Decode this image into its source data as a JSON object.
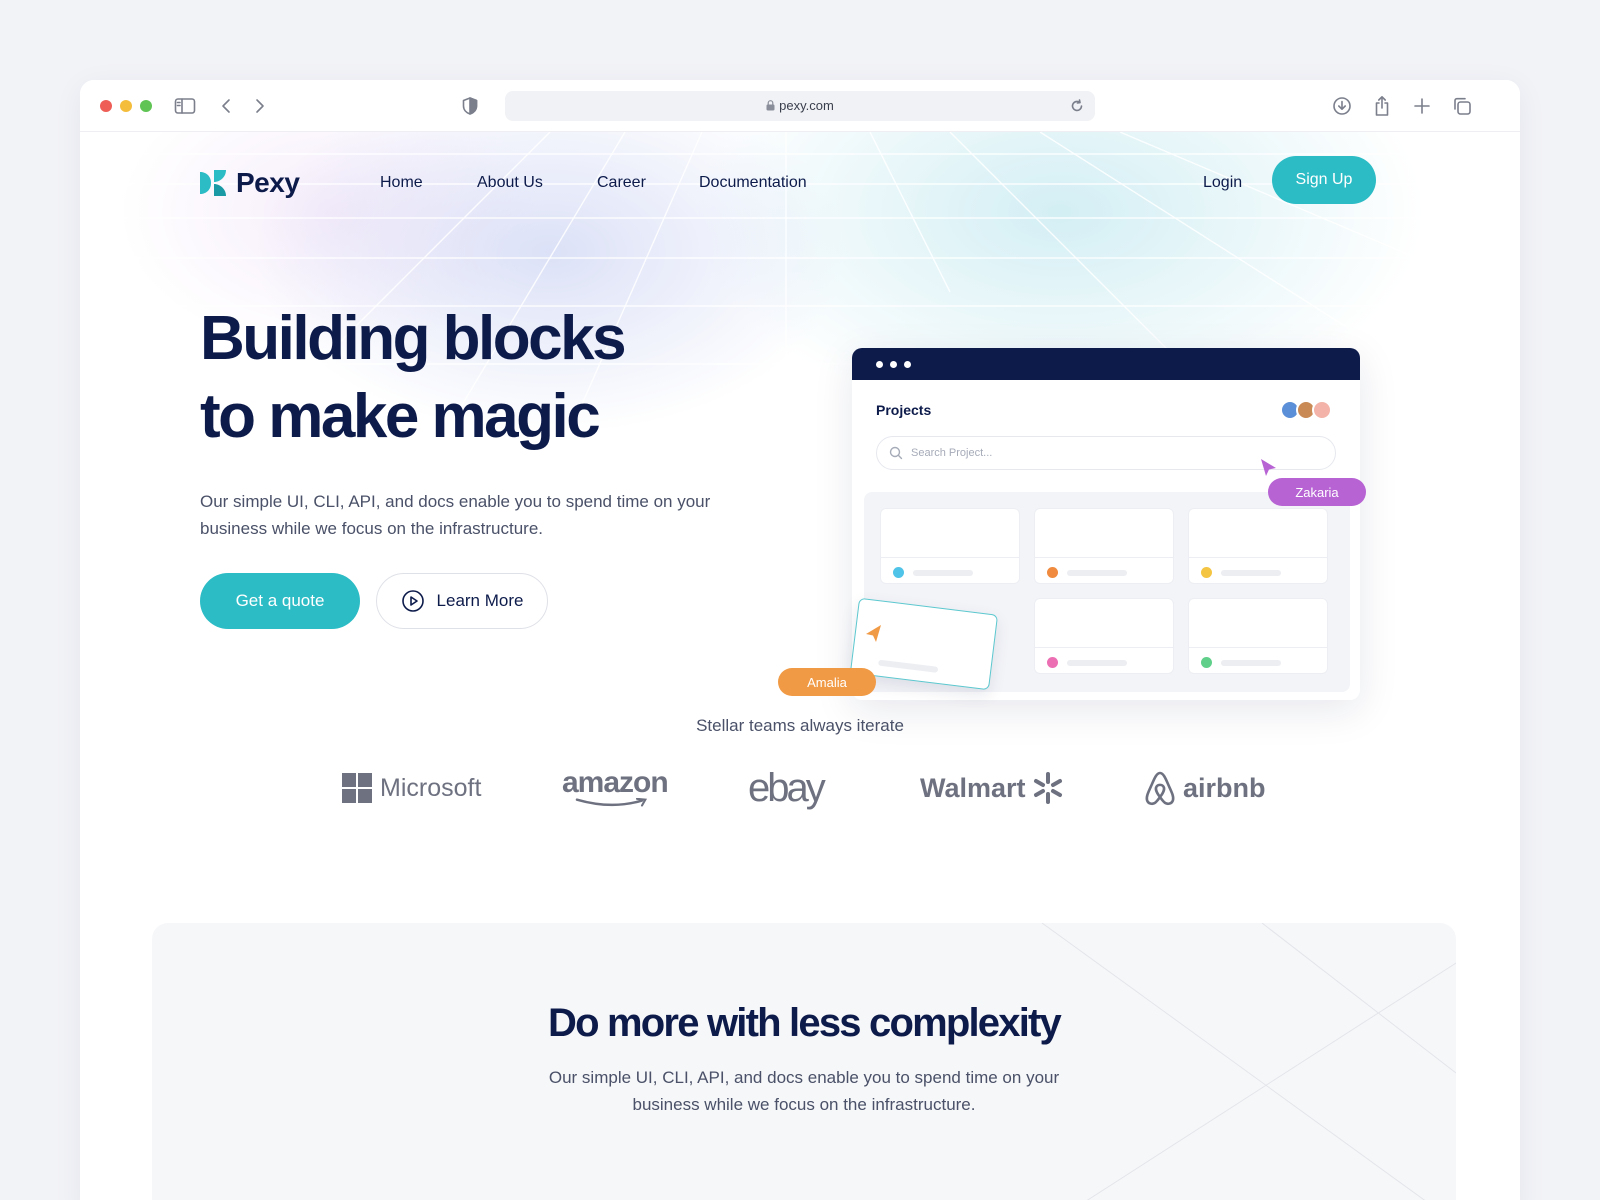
{
  "browser": {
    "url": "pexy.com"
  },
  "nav": {
    "brand": "Pexy",
    "links": [
      "Home",
      "About Us",
      "Career",
      "Documentation"
    ],
    "login": "Login",
    "signup": "Sign Up"
  },
  "hero": {
    "headline_line1": "Building blocks",
    "headline_line2": "to make magic",
    "subtext": "Our simple UI, CLI, API, and docs enable you to spend time on your business while we focus on the infrastructure.",
    "cta_primary": "Get a quote",
    "cta_secondary": "Learn More"
  },
  "mockup": {
    "title": "Projects",
    "search_placeholder": "Search Project...",
    "cursor_labels": [
      "Zakaria",
      "Amalia"
    ],
    "card_dot_colors": [
      "#4fc3e8",
      "#f08a3e",
      "#f4c542",
      "#ec6fb4",
      "#5fcf8a"
    ]
  },
  "colors": {
    "accent": "#2cbcc5",
    "navy": "#0d1b4b",
    "zakaria": "#b763d4",
    "amalia": "#f19a45"
  },
  "logos": {
    "title": "Stellar teams always iterate",
    "brands": [
      "Microsoft",
      "amazon",
      "ebay",
      "Walmart",
      "airbnb"
    ]
  },
  "section2": {
    "title": "Do more with less complexity",
    "subtext": "Our simple UI, CLI, API, and docs enable you to spend time on your business while we focus on the infrastructure."
  }
}
